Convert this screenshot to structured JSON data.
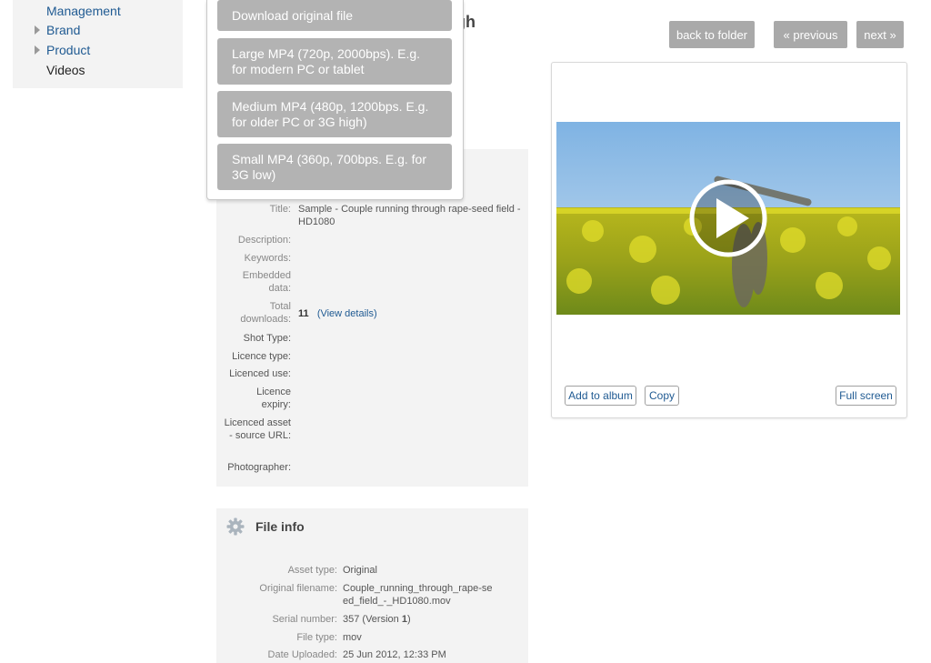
{
  "sidebar": {
    "items": [
      {
        "label": "Management"
      },
      {
        "label": "Brand"
      },
      {
        "label": "Product"
      },
      {
        "label": "Videos"
      }
    ]
  },
  "page": {
    "title_fragment": "ugh"
  },
  "nav": {
    "back_label": "back to folder",
    "previous_label": "« previous",
    "next_label": "next »"
  },
  "download_menu": {
    "items": [
      "Download original file",
      "Large MP4 (720p, 2000bps). E.g. for modern PC or tablet",
      "Medium MP4 (480p, 1200bps. E.g. for older PC or 3G high)",
      "Small MP4 (360p, 700bps. E.g. for 3G low)"
    ]
  },
  "details": {
    "title_label": "Title:",
    "title_value": "Sample - Couple running through rape-seed field - HD1080",
    "description_label": "Description:",
    "keywords_label": "Keywords:",
    "embedded_label": "Embedded data:",
    "downloads_label": "Total downloads:",
    "downloads_value": "11",
    "downloads_link": "(View details)",
    "shot_label": "Shot Type:",
    "licence_type_label": "Licence type:",
    "licenced_use_label": "Licenced use:",
    "licence_expiry_label": "Licence expiry:",
    "licenced_asset_label": "Licenced asset - source URL:",
    "photographer_label": "Photographer:"
  },
  "file_info": {
    "heading": "File info",
    "asset_type_label": "Asset type:",
    "asset_type_value": "Original",
    "orig_filename_label": "Original filename:",
    "orig_filename_value": "Couple_running_through_rape-seed_field_-_HD1080.mov",
    "serial_label": "Serial number:",
    "serial_value": "357 (Version ",
    "serial_version": "1",
    "serial_close": ")",
    "file_type_label": "File type:",
    "file_type_value": "mov",
    "date_uploaded_label": "Date Uploaded:",
    "date_uploaded_value": "25 Jun 2012, 12:33 PM"
  },
  "card": {
    "add_album_label": "Add to album",
    "copy_label": "Copy",
    "fullscreen_label": "Full screen"
  },
  "colors": {
    "link": "#1f5a92",
    "button_grey": "#a9a9a9",
    "panel_bg": "#f3f3f3",
    "field_yellow": "#c8c21a",
    "sky_blue": "#8fbfe6"
  }
}
